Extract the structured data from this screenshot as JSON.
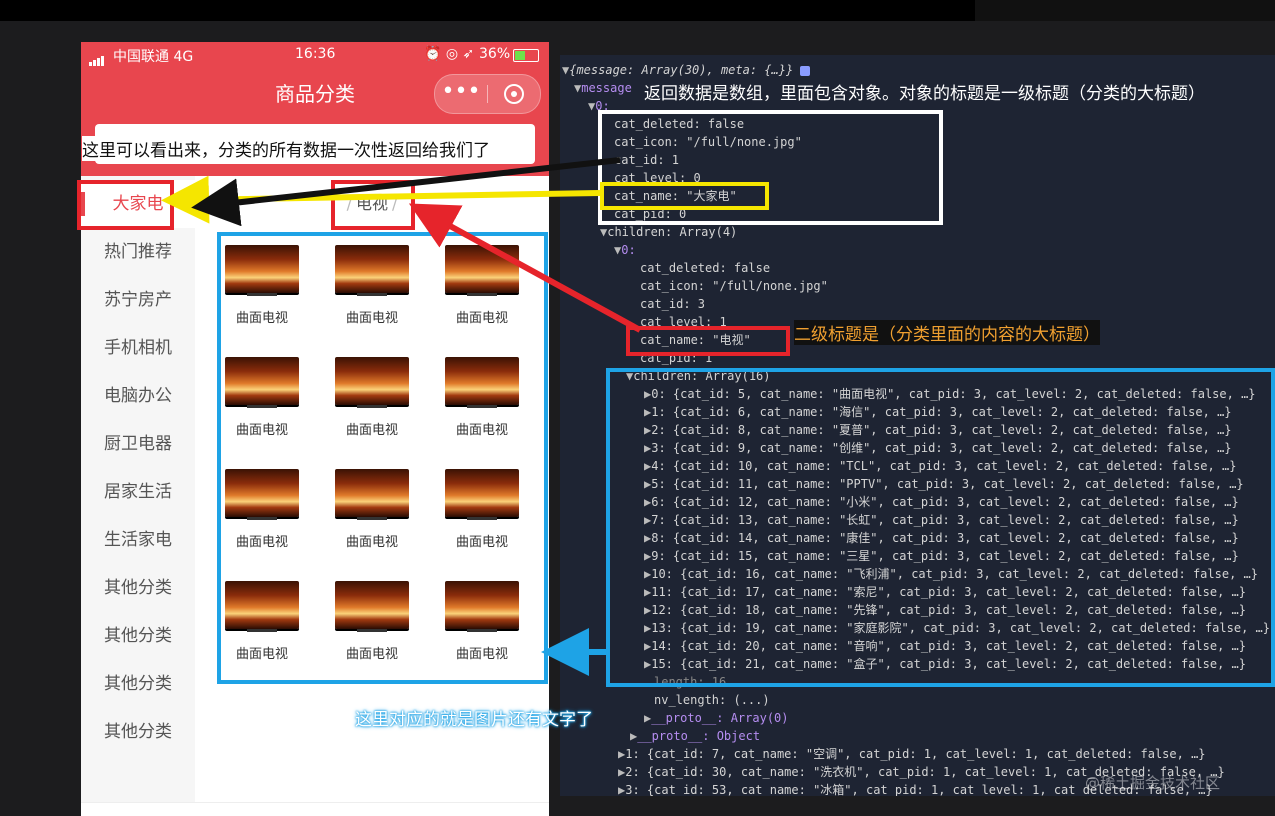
{
  "status": {
    "carrier": "中国联通 4G",
    "time": "16:36",
    "battery": "36%"
  },
  "header": {
    "title": "商品分类"
  },
  "capsule": {
    "more": "•••"
  },
  "sidebar": {
    "items": [
      {
        "label": "大家电"
      },
      {
        "label": "热门推荐"
      },
      {
        "label": "苏宁房产"
      },
      {
        "label": "手机相机"
      },
      {
        "label": "电脑办公"
      },
      {
        "label": "厨卫电器"
      },
      {
        "label": "居家生活"
      },
      {
        "label": "生活家电"
      },
      {
        "label": "其他分类"
      },
      {
        "label": "其他分类"
      },
      {
        "label": "其他分类"
      },
      {
        "label": "其他分类"
      }
    ]
  },
  "category": {
    "title": "电视",
    "slash": "/"
  },
  "grid": {
    "items": [
      {
        "label": "曲面电视"
      },
      {
        "label": "曲面电视"
      },
      {
        "label": "曲面电视"
      },
      {
        "label": "曲面电视"
      },
      {
        "label": "曲面电视"
      },
      {
        "label": "曲面电视"
      },
      {
        "label": "曲面电视"
      },
      {
        "label": "曲面电视"
      },
      {
        "label": "曲面电视"
      },
      {
        "label": "曲面电视"
      },
      {
        "label": "曲面电视"
      },
      {
        "label": "曲面电视"
      }
    ]
  },
  "annotations": {
    "top_note": "这里可以看出来，分类的所有数据一次性返回给我们了",
    "array_note": "返回数据是数组，里面包含对象。对象的标题是一级标题（分类的大标题）",
    "second_note": "二级标题是（分类里面的内容的大标题）",
    "bottom_note": "这里对应的就是图片还有文字了"
  },
  "console": {
    "lines": [
      "{message: Array(30), meta: {…}}",
      "message",
      "0:",
      "cat_deleted: false",
      "cat_icon: \"/full/none.jpg\"",
      "cat_id: 1",
      "cat_level: 0",
      "cat_name: \"大家电\"",
      "cat_pid: 0",
      "children: Array(4)",
      "0:",
      "cat_deleted: false",
      "cat_icon: \"/full/none.jpg\"",
      "cat_id: 3",
      "cat_level: 1",
      "cat_name: \"电视\"",
      "cat_pid: 1",
      "children: Array(16)",
      "0: {cat_id: 5, cat_name: \"曲面电视\", cat_pid: 3, cat_level: 2, cat_deleted: false, …}",
      "1: {cat_id: 6, cat_name: \"海信\", cat_pid: 3, cat_level: 2, cat_deleted: false, …}",
      "2: {cat_id: 8, cat_name: \"夏普\", cat_pid: 3, cat_level: 2, cat_deleted: false, …}",
      "3: {cat_id: 9, cat_name: \"创维\", cat_pid: 3, cat_level: 2, cat_deleted: false, …}",
      "4: {cat_id: 10, cat_name: \"TCL\", cat_pid: 3, cat_level: 2, cat_deleted: false, …}",
      "5: {cat_id: 11, cat_name: \"PPTV\", cat_pid: 3, cat_level: 2, cat_deleted: false, …}",
      "6: {cat_id: 12, cat_name: \"小米\", cat_pid: 3, cat_level: 2, cat_deleted: false, …}",
      "7: {cat_id: 13, cat_name: \"长虹\", cat_pid: 3, cat_level: 2, cat_deleted: false, …}",
      "8: {cat_id: 14, cat_name: \"康佳\", cat_pid: 3, cat_level: 2, cat_deleted: false, …}",
      "9: {cat_id: 15, cat_name: \"三星\", cat_pid: 3, cat_level: 2, cat_deleted: false, …}",
      "10: {cat_id: 16, cat_name: \"飞利浦\", cat_pid: 3, cat_level: 2, cat_deleted: false, …}",
      "11: {cat_id: 17, cat_name: \"索尼\", cat_pid: 3, cat_level: 2, cat_deleted: false, …}",
      "12: {cat_id: 18, cat_name: \"先锋\", cat_pid: 3, cat_level: 2, cat_deleted: false, …}",
      "13: {cat_id: 19, cat_name: \"家庭影院\", cat_pid: 3, cat_level: 2, cat_deleted: false, …}",
      "14: {cat_id: 20, cat_name: \"音响\", cat_pid: 3, cat_level: 2, cat_deleted: false, …}",
      "15: {cat_id: 21, cat_name: \"盒子\", cat_pid: 3, cat_level: 2, cat_deleted: false, …}",
      "length: 16",
      "nv_length: (...)",
      "__proto__: Array(0)",
      "__proto__: Object",
      "1: {cat_id: 7, cat_name: \"空调\", cat_pid: 1, cat_level: 1, cat_deleted: false, …}",
      "2: {cat_id: 30, cat_name: \"洗衣机\", cat_pid: 1, cat_level: 1, cat_deleted: false, …}",
      "3: {cat_id: 53, cat_name: \"冰箱\", cat_pid: 1, cat_level: 1, cat_deleted: false, …}"
    ]
  },
  "watermark": "@稀土掘金技术社区",
  "colors": {
    "brand": "#e8464e",
    "console_bg": "#1e2433",
    "yellow": "#f5e600",
    "blue": "#1ea3e6",
    "red": "#e6242b"
  }
}
